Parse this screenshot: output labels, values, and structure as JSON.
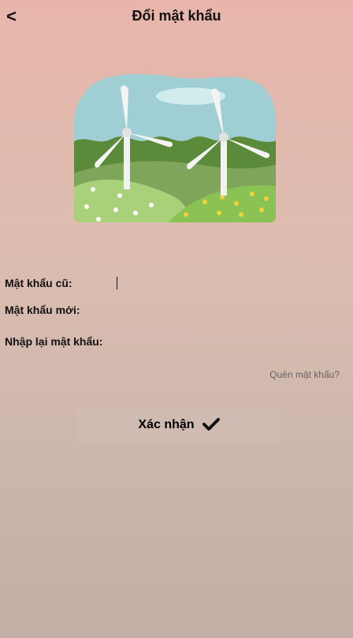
{
  "header": {
    "back_label": "<",
    "title": "Đổi mật khẩu"
  },
  "illustration": {
    "name": "wind-turbines-illustration",
    "colors": {
      "sky": "#9fcfd4",
      "hills_dark": "#5b8a3a",
      "hills_mid": "#7da855",
      "meadow": "#a8d17a"
    }
  },
  "form": {
    "old_password": {
      "label": "Mật khẩu cũ:",
      "value": ""
    },
    "new_password": {
      "label": "Mật khẩu mới:",
      "value": ""
    },
    "confirm_password": {
      "label": "Nhập lại mật khẩu:",
      "value": ""
    }
  },
  "forgot_link": "Quên mật khẩu?",
  "confirm_button": {
    "label": "Xác nhận",
    "icon": "check-icon"
  }
}
